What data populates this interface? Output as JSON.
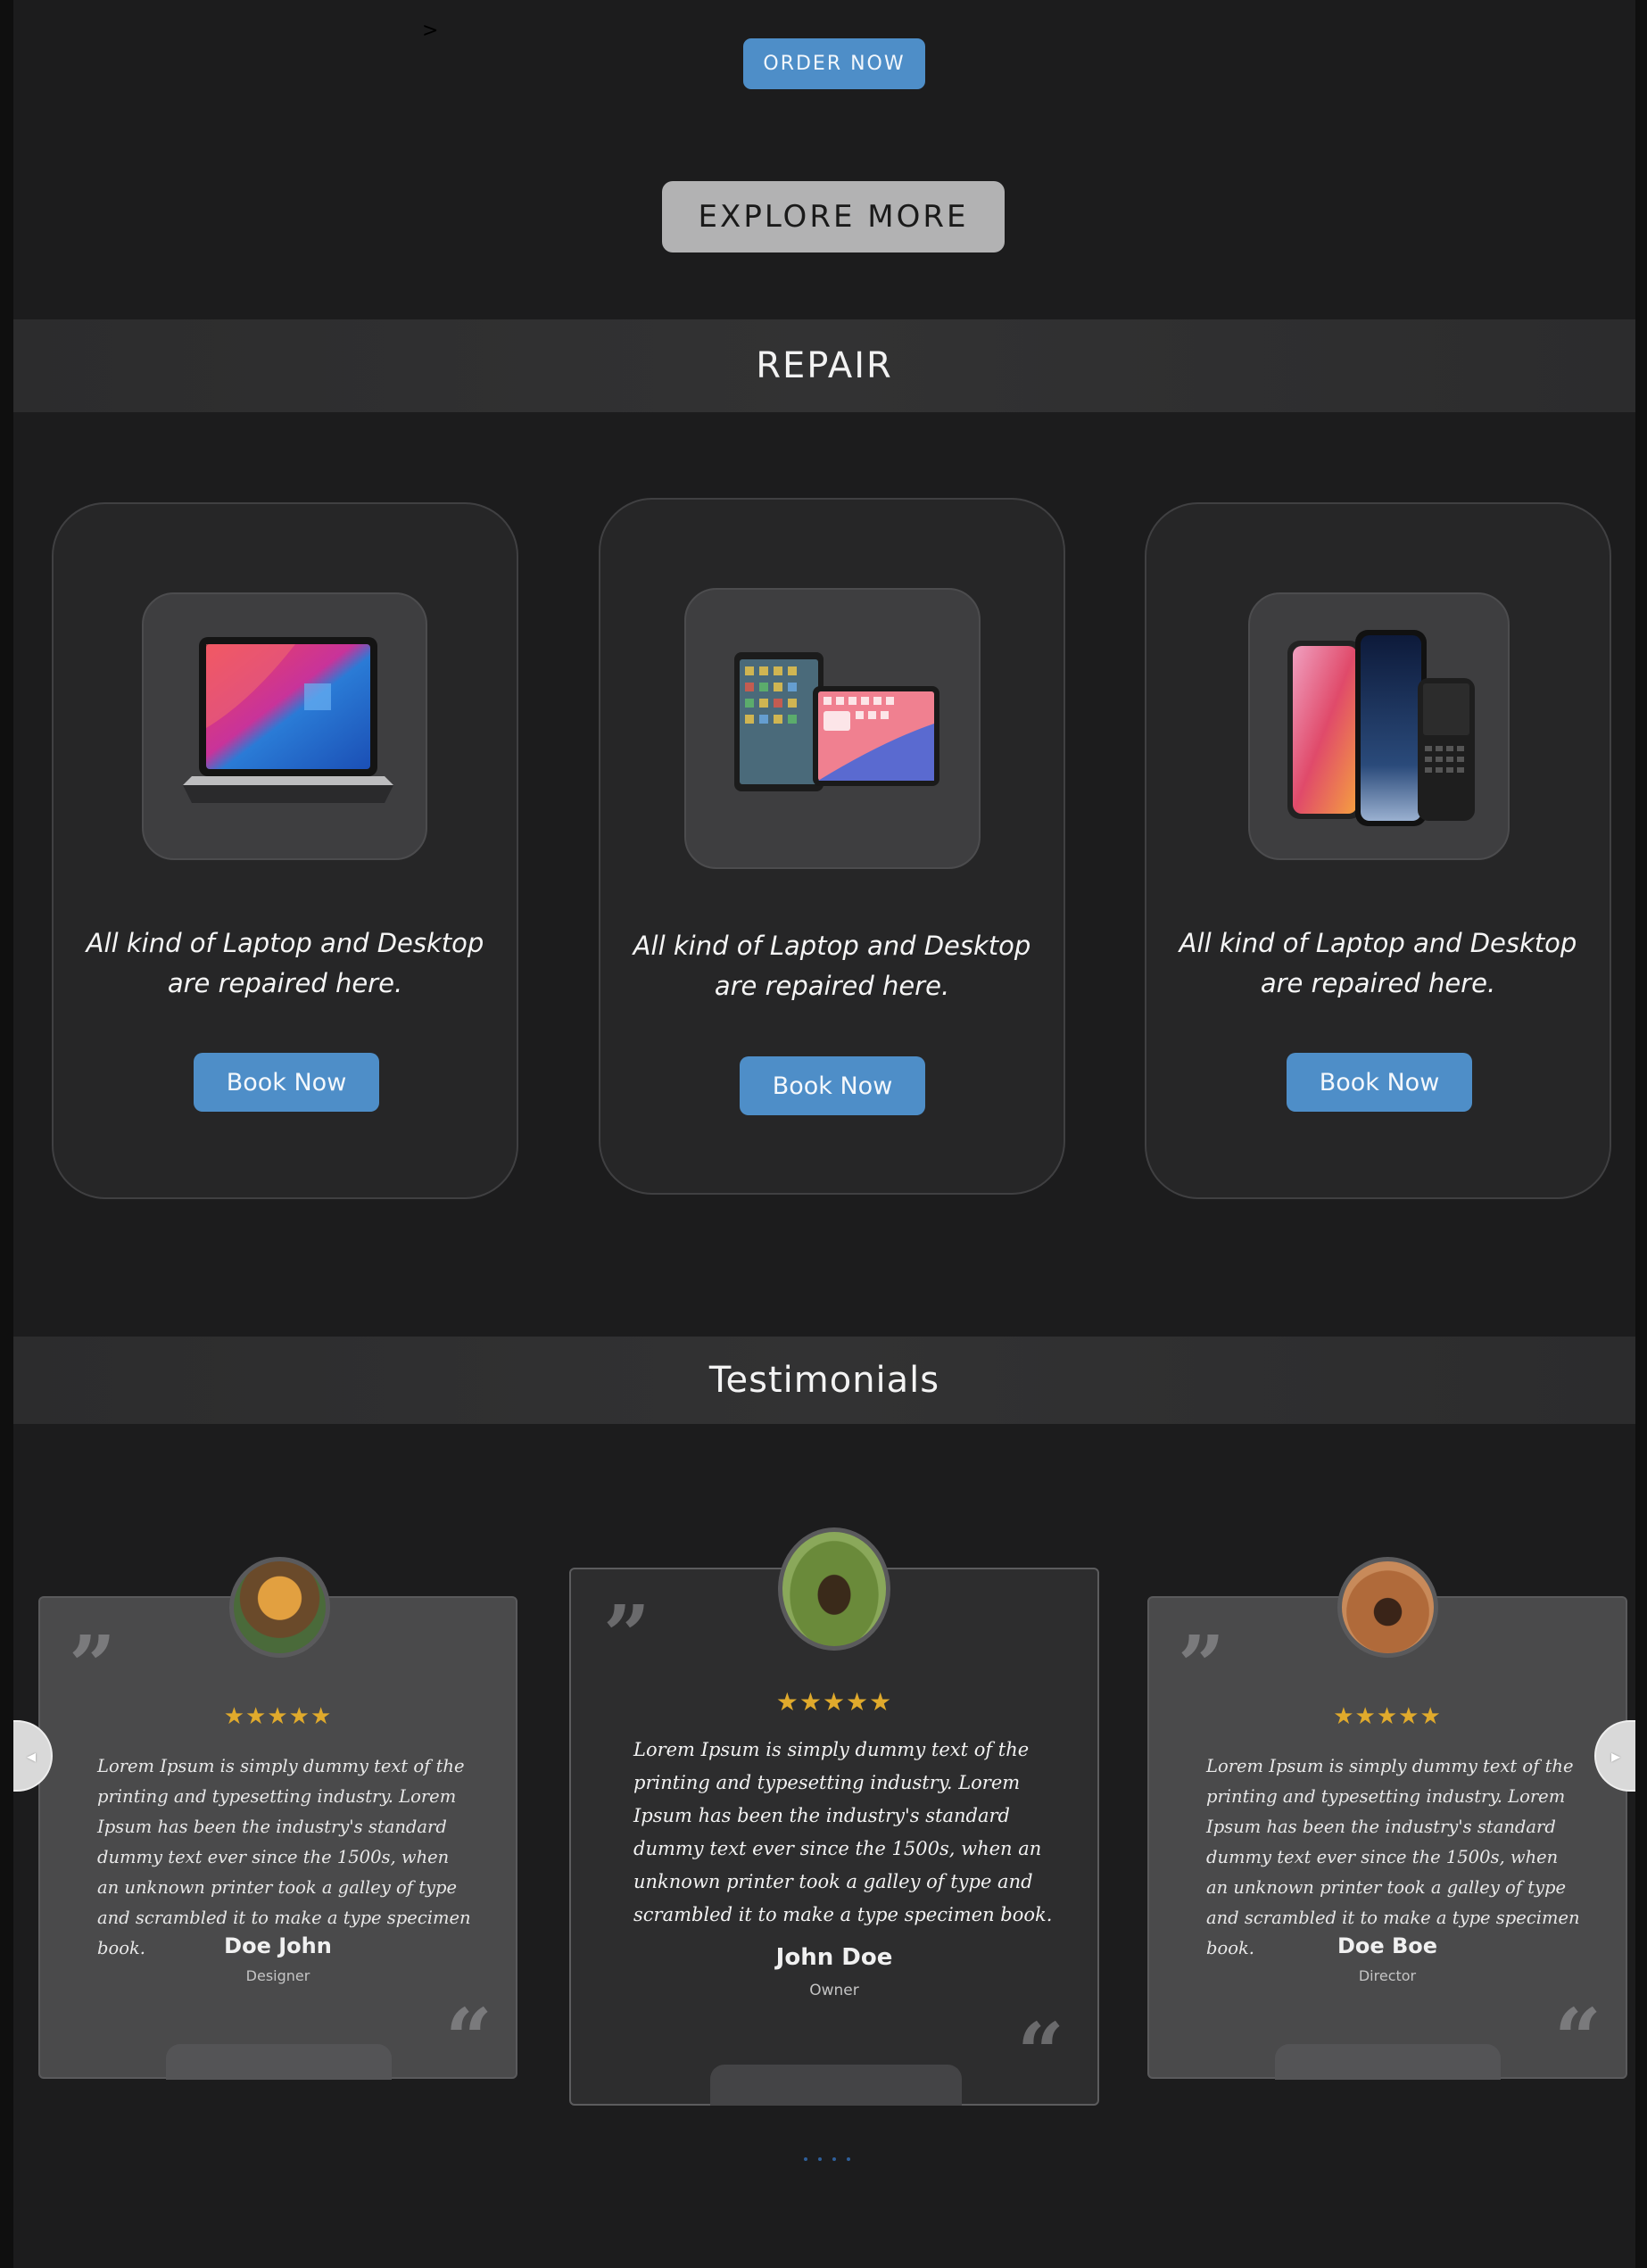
{
  "stray_mark": ">",
  "hero": {
    "order_now_label": "ORDER NOW",
    "explore_more_label": "EXPLORE MORE"
  },
  "repair": {
    "section_title": "REPAIR",
    "cards": [
      {
        "image": "laptop-image",
        "description": "All kind of Laptop and Desktop are repaired here.",
        "button_label": "Book Now"
      },
      {
        "image": "tablet-image",
        "description": "All kind of Laptop and Desktop are repaired here.",
        "button_label": "Book Now"
      },
      {
        "image": "phones-image",
        "description": "All kind of Laptop and Desktop are repaired here.",
        "button_label": "Book Now"
      }
    ]
  },
  "testimonials": {
    "section_title": "Testimonials",
    "cards": [
      {
        "name": "Doe John",
        "role": "Designer",
        "rating": 5,
        "stars": "★★★★★",
        "text": "Lorem Ipsum is simply dummy text of the printing and typesetting industry. Lorem Ipsum has been the industry's standard dummy text ever since the 1500s, when an unknown printer took a galley of type and scrambled it to make a type specimen book."
      },
      {
        "name": "John Doe",
        "role": "Owner",
        "rating": 5,
        "stars": "★★★★★",
        "text": "Lorem Ipsum is simply dummy text of the printing and typesetting industry. Lorem Ipsum has been the industry's standard dummy text ever since the 1500s, when an unknown printer took a galley of type and scrambled it to make a type specimen book."
      },
      {
        "name": "Doe Boe",
        "role": "Director",
        "rating": 5,
        "stars": "★★★★★",
        "text": "Lorem Ipsum is simply dummy text of the printing and typesetting industry. Lorem Ipsum has been the industry's standard dummy text ever since the 1500s, when an unknown printer took a galley of type and scrambled it to make a type specimen book."
      }
    ],
    "quote_open_glyph": "”",
    "quote_close_glyph": "“",
    "prev_icon": "◂",
    "next_icon": "▸",
    "pagination_dot_count": 4
  },
  "colors": {
    "accent_blue": "#4e8ec8",
    "page_background": "#1c1c1d",
    "star_gold": "#e0aa2c"
  }
}
